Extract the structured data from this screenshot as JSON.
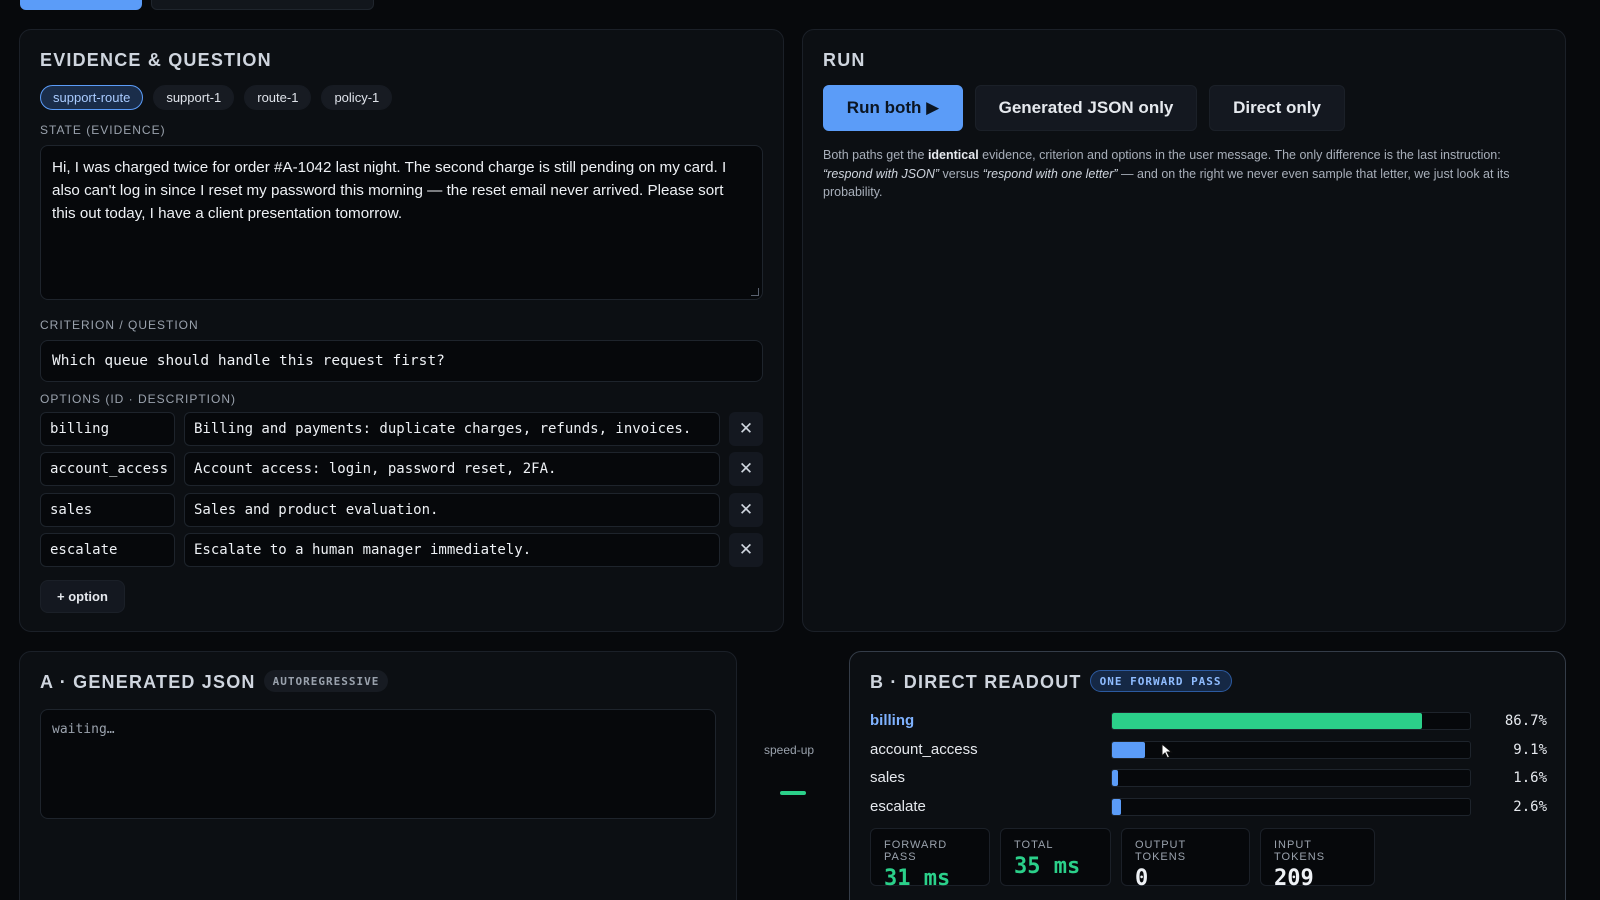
{
  "evidence": {
    "title": "EVIDENCE & QUESTION",
    "chips": [
      "support-route",
      "support-1",
      "route-1",
      "policy-1"
    ],
    "state_label": "STATE (EVIDENCE)",
    "state_text": "Hi, I was charged twice for order #A-1042 last night. The second charge is still pending on my card. I also can't log in since I reset my password this morning — the reset email never arrived. Please sort this out today, I have a client presentation tomorrow.",
    "question_label": "CRITERION / QUESTION",
    "question_text": "Which queue should handle this request first?",
    "options_label": "OPTIONS (ID · DESCRIPTION)",
    "options": [
      {
        "id": "billing",
        "desc": "Billing and payments: duplicate charges, refunds, invoices."
      },
      {
        "id": "account_access",
        "desc": "Account access: login, password reset, 2FA."
      },
      {
        "id": "sales",
        "desc": "Sales and product evaluation."
      },
      {
        "id": "escalate",
        "desc": "Escalate to a human manager immediately."
      }
    ],
    "delete_glyph": "✕",
    "add_option_label": "+ option"
  },
  "run": {
    "title": "RUN",
    "run_both_label": "Run both ▶",
    "json_only_label": "Generated JSON only",
    "direct_only_label": "Direct only",
    "desc_1": "Both paths get the ",
    "desc_bold": "identical",
    "desc_2": " evidence, criterion and options in the user message. The only difference is the last instruction: ",
    "desc_italic_1": "“respond with JSON”",
    "desc_3": " versus ",
    "desc_italic_2": "“respond with one letter”",
    "desc_4": " — and on the right we never even sample that letter, we just look at its probability."
  },
  "panel_a": {
    "title": "A · GENERATED JSON",
    "badge": "AUTOREGRESSIVE",
    "output": "waiting…"
  },
  "speedup": {
    "label": "speed-up"
  },
  "panel_b": {
    "title": "B · DIRECT READOUT",
    "badge": "ONE FORWARD PASS",
    "probabilities": [
      {
        "name": "billing",
        "value": 86.7,
        "label": "86.7%"
      },
      {
        "name": "account_access",
        "value": 9.1,
        "label": "9.1%"
      },
      {
        "name": "sales",
        "value": 1.6,
        "label": "1.6%"
      },
      {
        "name": "escalate",
        "value": 2.6,
        "label": "2.6%"
      }
    ],
    "stats": [
      {
        "key": "FORWARD PASS",
        "value": "31 ms"
      },
      {
        "key": "TOTAL",
        "value": "35 ms"
      },
      {
        "key": "OUTPUT TOKENS",
        "value": "0"
      },
      {
        "key": "INPUT TOKENS",
        "value": "209"
      }
    ]
  },
  "colors": {
    "accent": "#5b9cf8",
    "success": "#2bd08a",
    "background": "#07090c",
    "panel": "#0c0f13"
  }
}
